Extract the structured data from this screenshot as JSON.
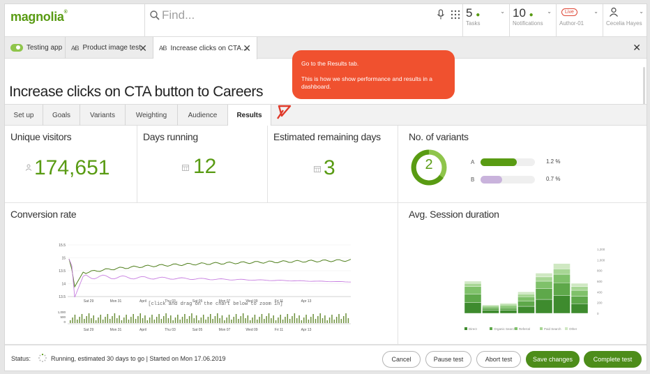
{
  "header": {
    "logo": "magnolia",
    "search_placeholder": "Find...",
    "tasks": {
      "count": "5",
      "label": "Tasks"
    },
    "notifications": {
      "count": "10",
      "label": "Notifications"
    },
    "env": {
      "badge": "Live",
      "label": "Author-01"
    },
    "user": {
      "name": "Cecelia Hayes"
    }
  },
  "app_tabs": [
    {
      "label": "Testing app"
    },
    {
      "label": "Product image test",
      "close": "✕"
    },
    {
      "label": "Increase clicks on CTA...",
      "close": "✕"
    }
  ],
  "close_all": "✕",
  "page": {
    "title": "Increase clicks on CTA button to Careers"
  },
  "sub_tabs": [
    "Set up",
    "Goals",
    "Variants",
    "Weighting",
    "Audience",
    "Results"
  ],
  "tooltip": {
    "line1": "Go to the Results tab.",
    "line2": "This is how we show performance and results in a dashboard."
  },
  "metrics": {
    "visitors": {
      "title": "Unique visitors",
      "value": "174,651"
    },
    "days": {
      "title": "Days running",
      "value": "12"
    },
    "remaining": {
      "title": "Estimated remaining days",
      "value": "3"
    },
    "variants": {
      "title": "No. of variants",
      "count": "2",
      "items": [
        {
          "label": "A",
          "value": "1.2 %",
          "fraction": 0.67,
          "color": "#599b13"
        },
        {
          "label": "B",
          "value": "0.7 %",
          "fraction": 0.4,
          "color": "#c9b3dc"
        }
      ]
    }
  },
  "conversion": {
    "title": "Conversion rate",
    "zoom_hint": "[click and drag on the chart below to zoom in]",
    "y_ticks": [
      "15.5",
      "15",
      "13.5",
      "14",
      "13.5"
    ],
    "x_ticks": [
      "Sat 29",
      "Mon 31",
      "April",
      "Thu 03",
      "Sat 05",
      "Mon 07",
      "Wed 09",
      "Fri 11",
      "Apr 13"
    ],
    "nav_y_ticks": [
      "1,000",
      "500",
      "0"
    ],
    "colors": {
      "a": "#4f7f1c",
      "b": "#c77de0"
    }
  },
  "session": {
    "title": "Avg. Session duration",
    "y_ticks": [
      "1,200",
      "1,000",
      "800",
      "600",
      "400",
      "200",
      "0"
    ],
    "legend": [
      "Direct",
      "Organic Search",
      "Referral",
      "Paid Search",
      "Other"
    ],
    "stacks": [
      [
        200,
        160,
        140,
        60,
        40
      ],
      [
        60,
        40,
        30,
        20,
        10
      ],
      [
        60,
        40,
        40,
        30,
        20
      ],
      [
        130,
        100,
        80,
        50,
        40
      ],
      [
        260,
        200,
        140,
        80,
        70
      ],
      [
        330,
        240,
        160,
        100,
        100
      ],
      [
        180,
        140,
        110,
        70,
        60
      ]
    ],
    "colors": [
      "#3e8b2e",
      "#5ea84a",
      "#7fc16a",
      "#a7d694",
      "#cfe8c2"
    ]
  },
  "footer": {
    "status_label": "Status:",
    "status_text": "Running, estimated 30 days to go  |  Started on Mon 17.06.2019",
    "buttons": {
      "cancel": "Cancel",
      "pause": "Pause test",
      "abort": "Abort test",
      "save": "Save changes",
      "complete": "Complete test"
    }
  }
}
